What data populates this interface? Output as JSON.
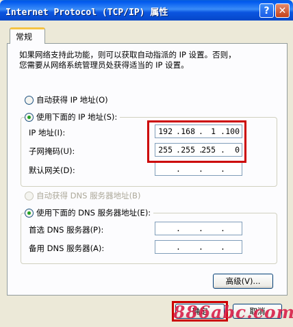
{
  "window": {
    "title": "Internet Protocol (TCP/IP) 属性",
    "help_label": "?",
    "close_label": "✕"
  },
  "tab": {
    "label": "常规"
  },
  "description": {
    "line1": "如果网络支持此功能，则可以获取自动指派的 IP 设置。否则，",
    "line2": "您需要从网络系统管理员处获得适当的 IP 设置。"
  },
  "ip": {
    "auto_label": "自动获得 IP 地址(O)",
    "manual_label": "使用下面的 IP 地址(S):",
    "selected": "manual",
    "address_label": "IP 地址(I):",
    "address": [
      "192",
      "168",
      "1",
      "100"
    ],
    "mask_label": "子网掩码(U):",
    "mask": [
      "255",
      "255",
      "255",
      "0"
    ],
    "gateway_label": "默认网关(D):",
    "gateway": [
      "",
      "",
      "",
      ""
    ]
  },
  "dns": {
    "auto_label": "自动获得 DNS 服务器地址(B)",
    "manual_label": "使用下面的 DNS 服务器地址(E):",
    "selected": "manual",
    "preferred_label": "首选 DNS 服务器(P):",
    "preferred": [
      "",
      "",
      "",
      ""
    ],
    "alternate_label": "备用 DNS 服务器(A):",
    "alternate": [
      "",
      "",
      "",
      ""
    ]
  },
  "buttons": {
    "advanced": "高级(V)...",
    "ok": "确定",
    "cancel": "取消"
  },
  "watermark": "886abc.com",
  "colors": {
    "titlebar": "#0058ee",
    "highlight": "#cc0000",
    "watermark": "#d9204a"
  }
}
